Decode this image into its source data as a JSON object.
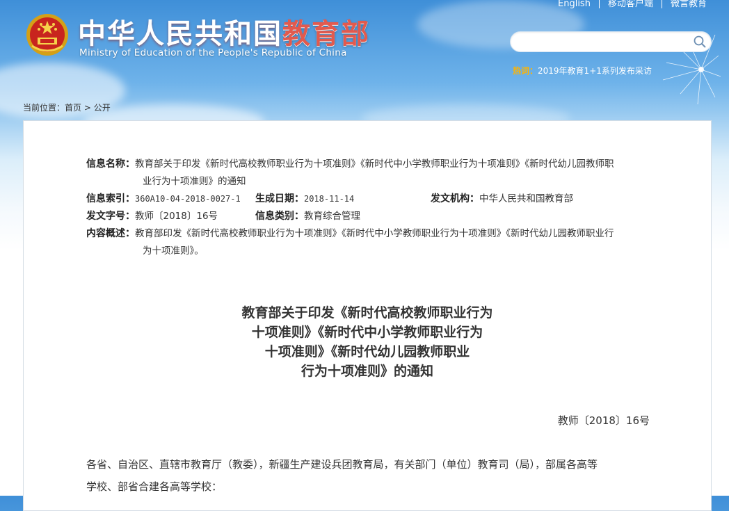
{
  "header": {
    "title_main": "中华人民共和国",
    "title_red": "教育部",
    "subtitle": "Ministry of Education of the People's Republic of China",
    "top_links": [
      "English",
      "移动客户端",
      "微言教育"
    ]
  },
  "search": {
    "placeholder": "",
    "value": ""
  },
  "hotword": {
    "label": "热词：",
    "text": "2019年教育1+1系列发布采访"
  },
  "breadcrumb": {
    "prefix": "当前位置：",
    "home": "首页",
    "sep": ">",
    "current": "公开"
  },
  "meta": {
    "name_label": "信息名称：",
    "name_line1": "教育部关于印发《新时代高校教师职业行为十项准则》《新时代中小学教师职业行为十项准则》《新时代幼儿园教师职",
    "name_line2": "业行为十项准则》的通知",
    "index_label": "信息索引：",
    "index_value": "360A10-04-2018-0027-1",
    "date_label": "生成日期：",
    "date_value": "2018-11-14",
    "org_label": "发文机构：",
    "org_value": "中华人民共和国教育部",
    "docno_label": "发文字号：",
    "docno_value": "教师〔2018〕16号",
    "category_label": "信息类别：",
    "category_value": "教育综合管理",
    "summary_label": "内容概述：",
    "summary_line1": "教育部印发《新时代高校教师职业行为十项准则》《新时代中小学教师职业行为十项准则》《新时代幼儿园教师职业行",
    "summary_line2": "为十项准则》。"
  },
  "document": {
    "title_lines": [
      "教育部关于印发《新时代高校教师职业行为",
      "十项准则》《新时代中小学教师职业行为",
      "十项准则》《新时代幼儿园教师职业",
      "行为十项准则》的通知"
    ],
    "number": "教师〔2018〕16号",
    "body_line1": "各省、自治区、直辖市教育厅（教委），新疆生产建设兵团教育局，有关部门（单位）教育司（局），部属各高等",
    "body_line2": "学校、部省合建各高等学校："
  },
  "colors": {
    "accent_red": "#e25a4e",
    "hot_orange": "#ffb400",
    "sky_blue": "#3f8fd8"
  }
}
